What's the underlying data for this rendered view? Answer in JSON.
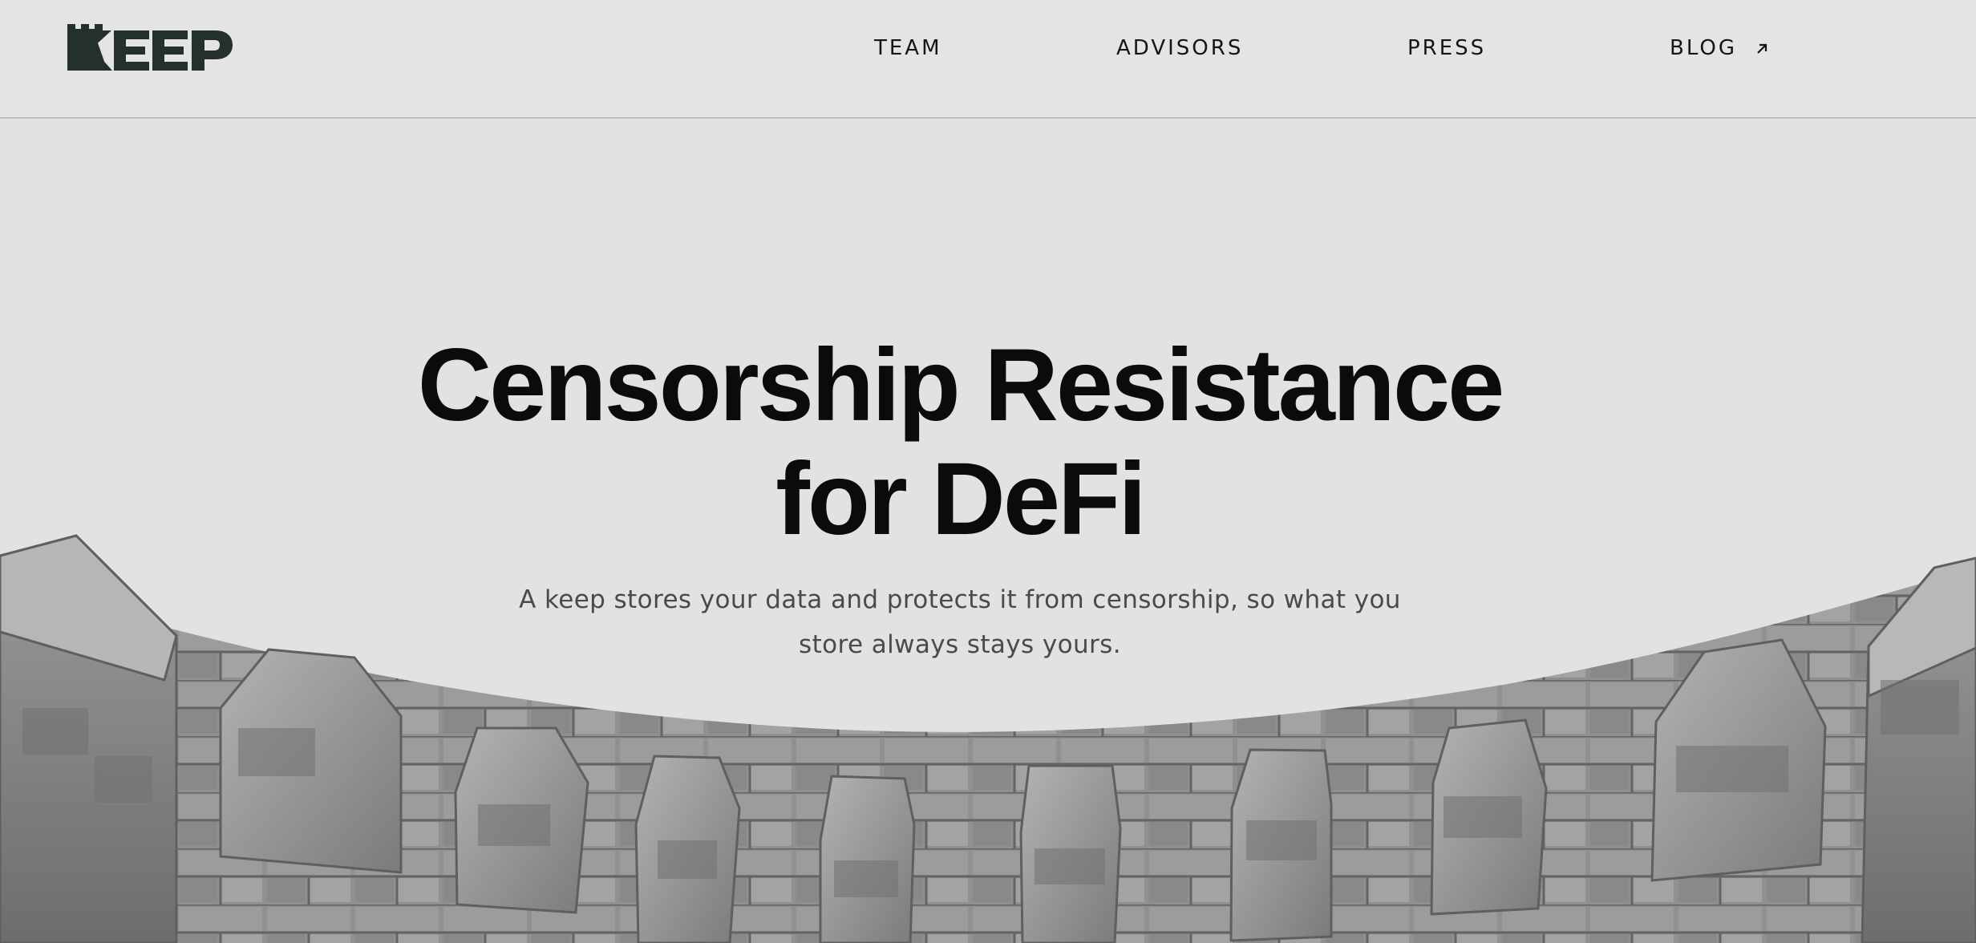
{
  "brand": {
    "logo_text": "KEEP",
    "logo_color": "#24302d"
  },
  "nav": {
    "items": [
      {
        "label": "TEAM"
      },
      {
        "label": "ADVISORS"
      },
      {
        "label": "PRESS"
      },
      {
        "label": "BLOG"
      }
    ],
    "blog_icon": "external-arrow-icon"
  },
  "hero": {
    "headline_line1": "Censorship Resistance",
    "headline_line2": "for DeFi",
    "subtitle_line1": "A keep stores your data and protects it from censorship, so what you",
    "subtitle_line2": "store always stays yours.",
    "background_image": "castle-battlements-photo"
  },
  "colors": {
    "background": "#e2e2e3",
    "text": "#0b0b09",
    "subtitle": "#4a4a4a",
    "divider": "#bdbdbd"
  }
}
